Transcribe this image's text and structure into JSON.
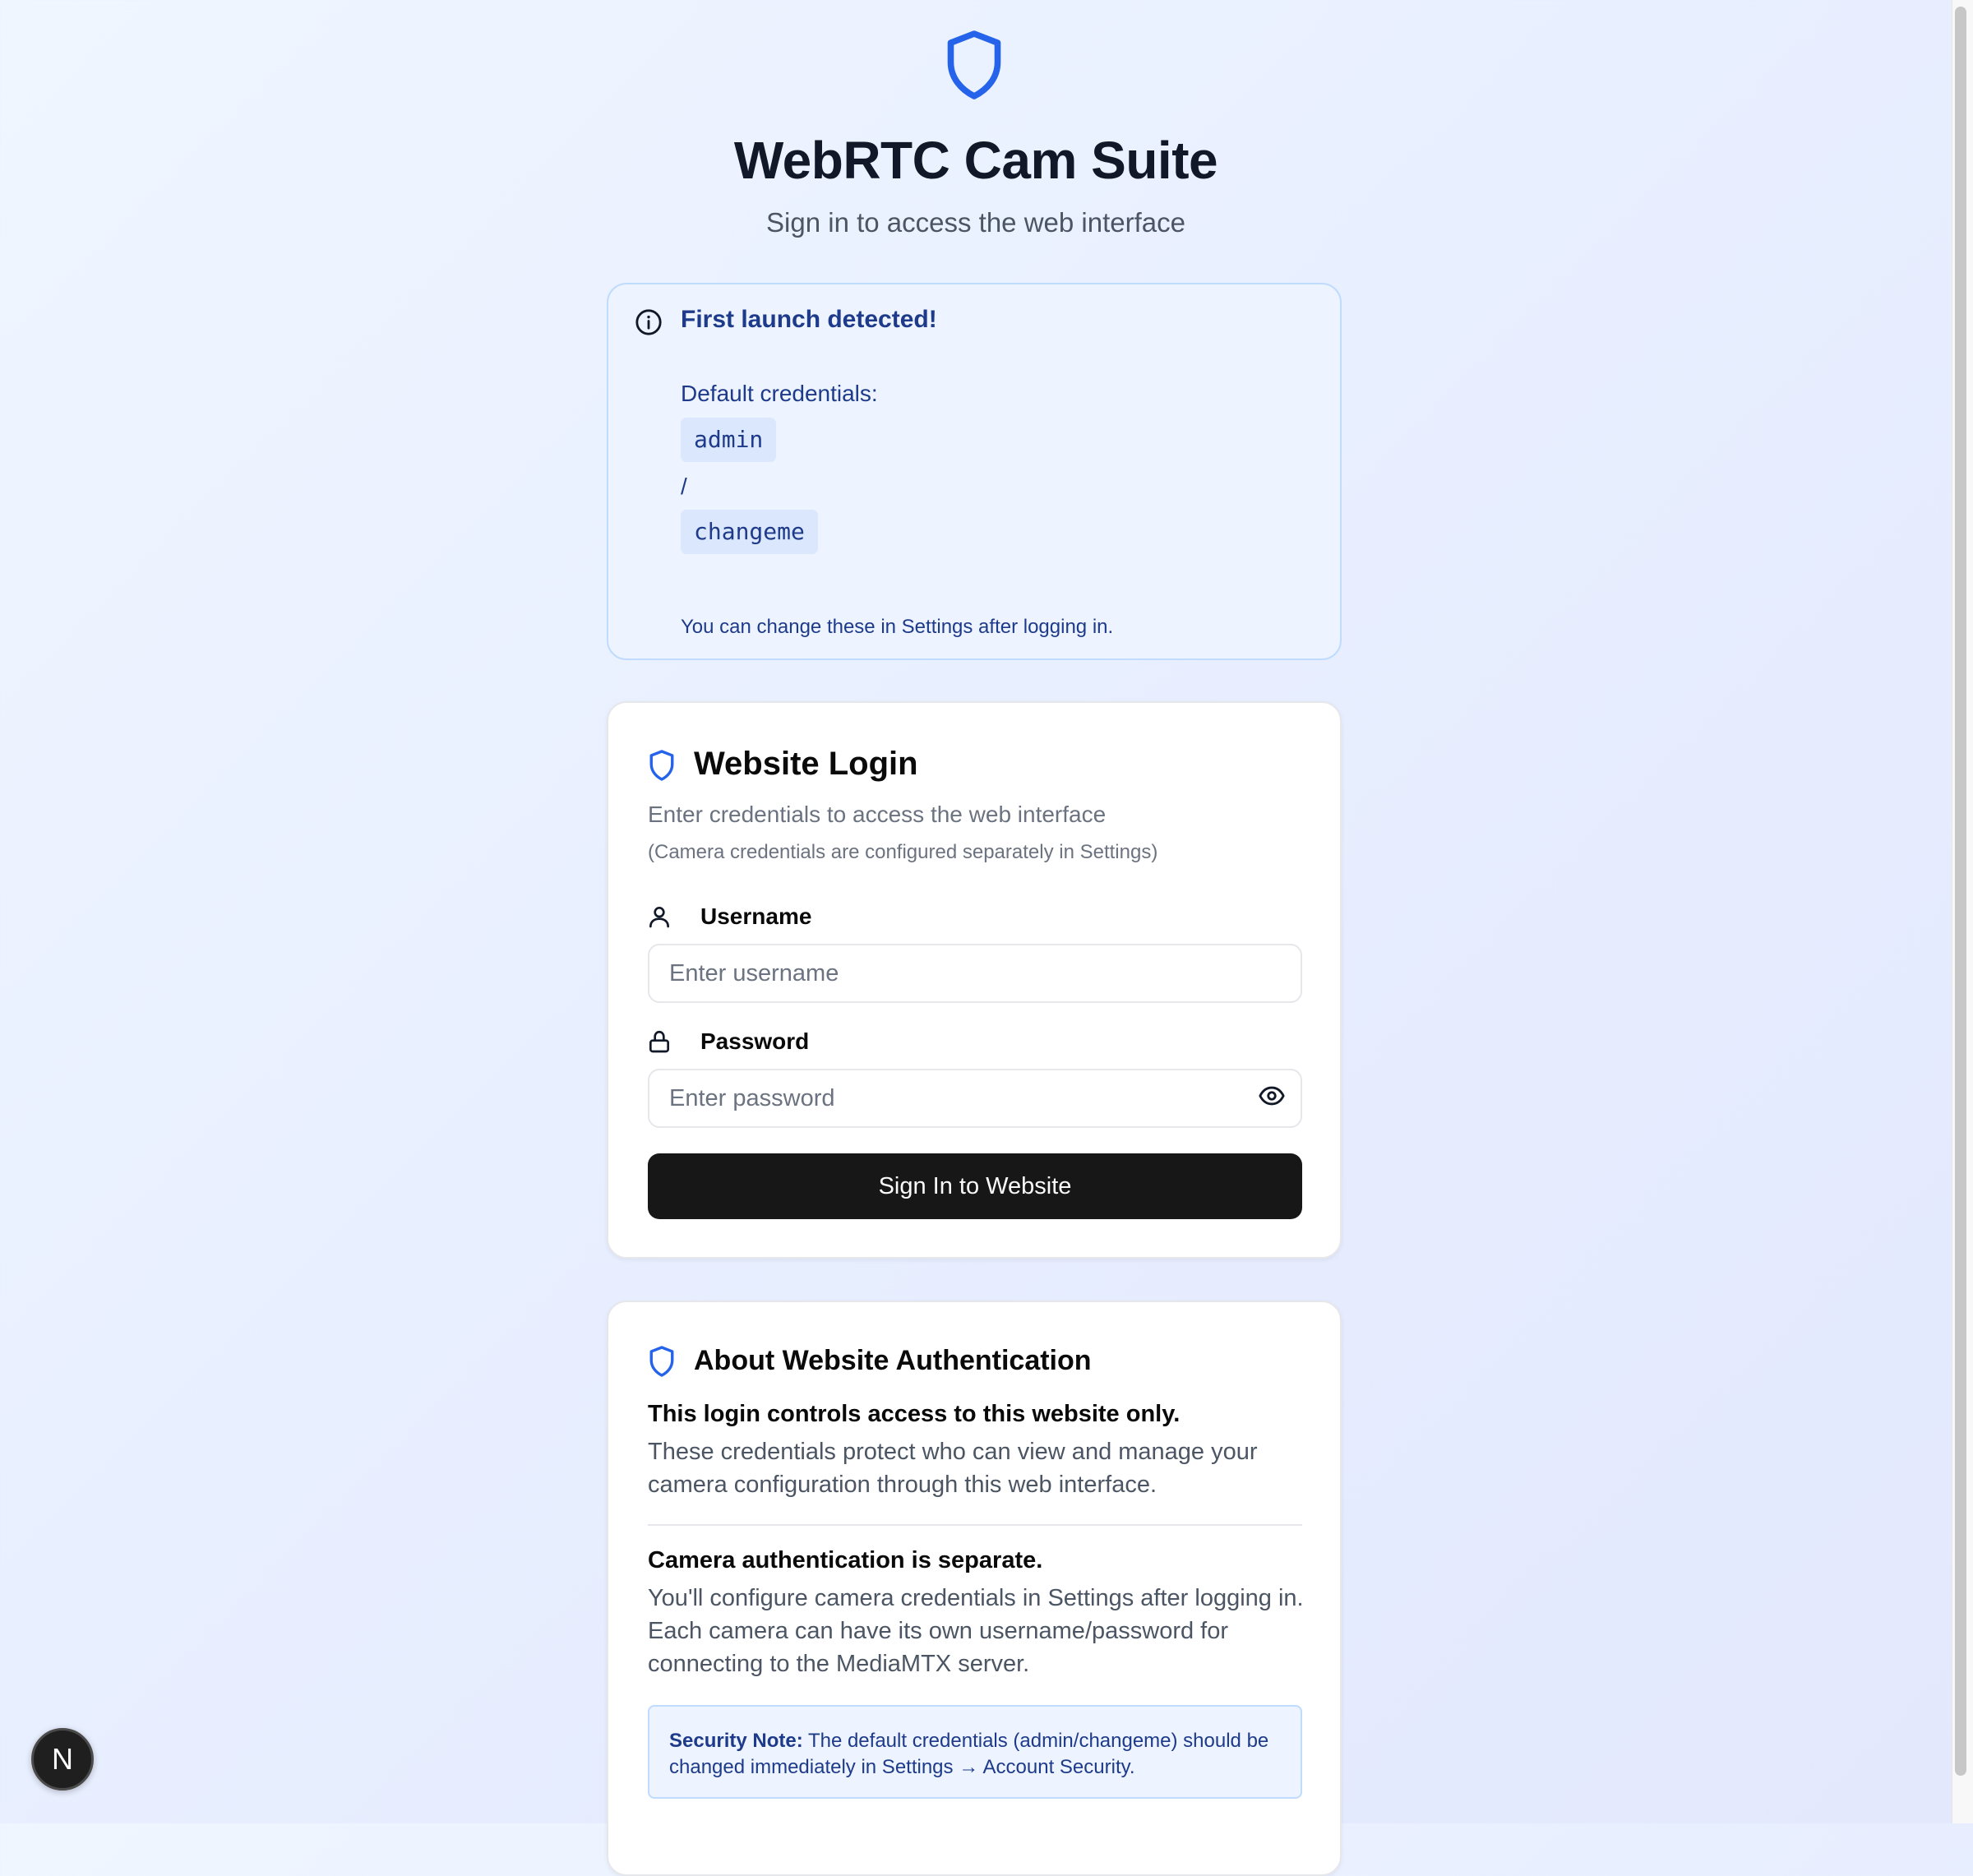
{
  "header": {
    "title": "WebRTC Cam Suite",
    "subtitle": "Sign in to access the web interface",
    "logo_icon": "shield-icon",
    "accent_color": "#2563eb"
  },
  "first_launch": {
    "title": "First launch detected!",
    "credentials_label": "Default credentials:",
    "username": "admin",
    "separator": "/",
    "password": "changeme",
    "note": "You can change these in Settings after logging in."
  },
  "login": {
    "title": "Website Login",
    "description": "Enter credentials to access the web interface",
    "sub_description": "(Camera credentials are configured separately in Settings)",
    "username_label": "Username",
    "username_placeholder": "Enter username",
    "username_value": "",
    "password_label": "Password",
    "password_placeholder": "Enter password",
    "password_value": "",
    "submit_label": "Sign In to Website"
  },
  "about": {
    "title": "About Website Authentication",
    "heading1": "This login controls access to this website only.",
    "text1": "These credentials protect who can view and manage your camera configuration through this web interface.",
    "heading2": "Camera authentication is separate.",
    "text2": "You'll configure camera credentials in Settings after logging in. Each camera can have its own username/password for connecting to the MediaMTX server.",
    "note_label": "Security Note:",
    "note_text": "The default credentials (admin/changeme) should be changed immediately in Settings → Account Security."
  },
  "dev_badge": {
    "label": "N"
  }
}
